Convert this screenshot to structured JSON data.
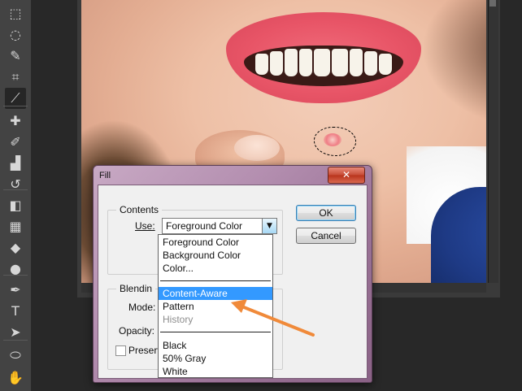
{
  "dialog": {
    "title": "Fill",
    "close_label": "✕",
    "contents": {
      "legend": "Contents",
      "use_label": "Use:",
      "use_value": "Foreground Color"
    },
    "blending": {
      "legend": "Blendin",
      "mode_label": "Mode:",
      "opacity_label": "Opacity:",
      "preserve_label": "Preserv"
    },
    "ok_label": "OK",
    "cancel_label": "Cancel"
  },
  "dropdown": {
    "items": [
      {
        "label": "Foreground Color",
        "state": "normal"
      },
      {
        "label": "Background Color",
        "state": "normal"
      },
      {
        "label": "Color...",
        "state": "normal"
      },
      {
        "label": "Content-Aware",
        "state": "selected"
      },
      {
        "label": "Pattern",
        "state": "normal"
      },
      {
        "label": "History",
        "state": "disabled"
      },
      {
        "label": "Black",
        "state": "normal"
      },
      {
        "label": "50% Gray",
        "state": "normal"
      },
      {
        "label": "White",
        "state": "normal"
      }
    ]
  },
  "toolbar": {
    "tools": [
      {
        "name": "marquee-icon",
        "glyph": "⬚"
      },
      {
        "name": "lasso-icon",
        "glyph": "◌"
      },
      {
        "name": "quick-selection-icon",
        "glyph": "✎"
      },
      {
        "name": "crop-icon",
        "glyph": "⌗"
      },
      {
        "name": "eyedropper-icon",
        "glyph": "⟋",
        "active": true
      },
      {
        "name": "healing-brush-icon",
        "glyph": "✚"
      },
      {
        "name": "brush-icon",
        "glyph": "✐"
      },
      {
        "name": "stamp-icon",
        "glyph": "▟"
      },
      {
        "name": "history-brush-icon",
        "glyph": "↺"
      },
      {
        "name": "eraser-icon",
        "glyph": "◧"
      },
      {
        "name": "gradient-icon",
        "glyph": "▦"
      },
      {
        "name": "blur-icon",
        "glyph": "◆"
      },
      {
        "name": "dodge-icon",
        "glyph": "●"
      },
      {
        "name": "pen-icon",
        "glyph": "✒"
      },
      {
        "name": "type-icon",
        "glyph": "T"
      },
      {
        "name": "path-selection-icon",
        "glyph": "➤"
      },
      {
        "name": "shape-icon",
        "glyph": "⬭"
      },
      {
        "name": "hand-icon",
        "glyph": "✋"
      }
    ]
  },
  "colors": {
    "annotation_arrow": "#f08a3a",
    "selected_item": "#3399ff"
  }
}
